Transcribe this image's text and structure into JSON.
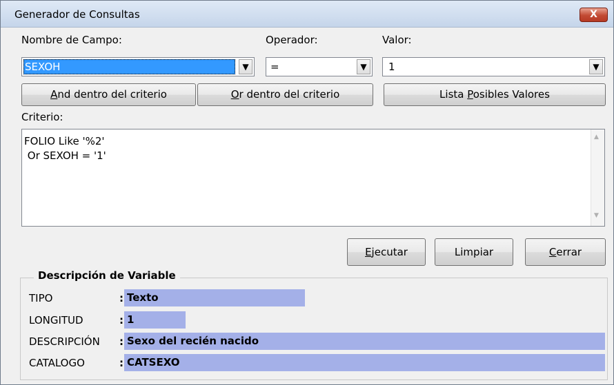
{
  "window": {
    "title": "Generador de Consultas",
    "close_glyph": "X"
  },
  "labels": {
    "field": "Nombre de Campo:",
    "operator": "Operador:",
    "value": "Valor:",
    "criteria": "Criterio:"
  },
  "field_combo": {
    "value": "SEXOH"
  },
  "operator_combo": {
    "value": "="
  },
  "value_combo": {
    "value": "1"
  },
  "buttons": {
    "and_pre": "",
    "and_u": "A",
    "and_post": "nd dentro del criterio",
    "or_pre": "",
    "or_u": "O",
    "or_post": "r dentro del criterio",
    "list_pre": "Lista ",
    "list_u": "P",
    "list_post": "osibles Valores",
    "exec_pre": "",
    "exec_u": "E",
    "exec_post": "jecutar",
    "clear_pre": "Limpiar",
    "clear_u": "",
    "clear_post": "",
    "close_pre": "",
    "close_u": "C",
    "close_post": "errar"
  },
  "criteria_text": [
    "FOLIO Like '%2'",
    " Or SEXOH = '1'"
  ],
  "variable": {
    "group_title": "Descripción de Variable",
    "rows": [
      {
        "label": "TIPO",
        "value": "Texto"
      },
      {
        "label": "LONGITUD",
        "value": "1"
      },
      {
        "label": "DESCRIPCIÓN",
        "value": "Sexo del recién nacido"
      },
      {
        "label": "CATALOGO",
        "value": "CATSEXO"
      }
    ],
    "separator": ":"
  },
  "colors": {
    "selection": "#3399ff",
    "value_highlight": "#a4b0e8"
  }
}
